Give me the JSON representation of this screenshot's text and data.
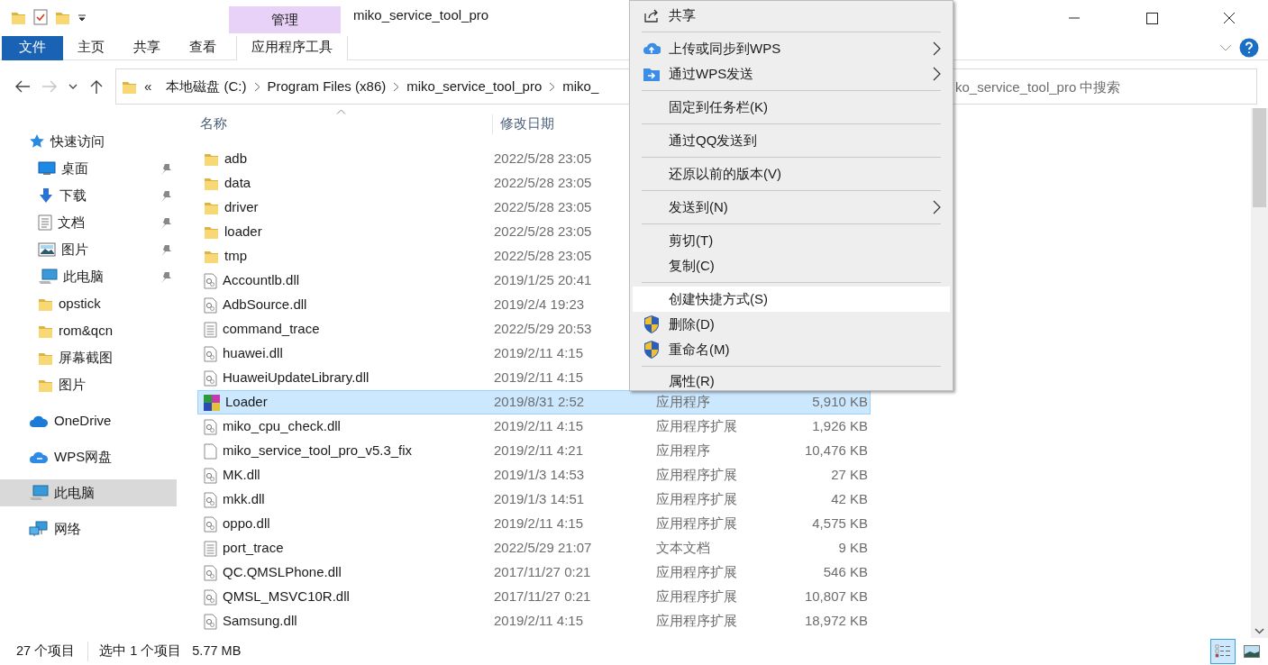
{
  "window": {
    "title": "miko_service_tool_pro",
    "context_group": "管理"
  },
  "ribbon": {
    "tabs": [
      {
        "label": "文件",
        "kind": "file"
      },
      {
        "label": "主页",
        "kind": "tab"
      },
      {
        "label": "共享",
        "kind": "tab"
      },
      {
        "label": "查看",
        "kind": "tab"
      },
      {
        "label": "应用程序工具",
        "kind": "context"
      }
    ]
  },
  "navigation": {
    "back": {
      "disabled": false
    },
    "forward": {
      "disabled": true
    }
  },
  "address_bar": {
    "overflow": "«",
    "path": [
      "本地磁盘 (C:)",
      "Program Files (x86)",
      "miko_service_tool_pro",
      "miko_"
    ]
  },
  "search": {
    "placeholder": "ko_service_tool_pro 中搜索"
  },
  "sidebar": {
    "items": [
      {
        "label": "快速访问",
        "kind": "star",
        "selected": false,
        "children": [
          {
            "label": "桌面",
            "kind": "desktop",
            "pinned": true,
            "selected": false
          },
          {
            "label": "下载",
            "kind": "download",
            "pinned": true,
            "selected": false
          },
          {
            "label": "文档",
            "kind": "document",
            "pinned": true,
            "selected": false
          },
          {
            "label": "图片",
            "kind": "pictures",
            "pinned": true,
            "selected": false
          },
          {
            "label": "此电脑",
            "kind": "pc",
            "pinned": true,
            "selected": false
          },
          {
            "label": "opstick",
            "kind": "folder",
            "pinned": false,
            "selected": false
          },
          {
            "label": "rom&qcn",
            "kind": "folder",
            "pinned": false,
            "selected": false
          },
          {
            "label": "屏幕截图",
            "kind": "folder",
            "pinned": false,
            "selected": false
          },
          {
            "label": "图片",
            "kind": "folder",
            "pinned": false,
            "selected": false
          }
        ]
      },
      {
        "label": "OneDrive",
        "kind": "cloud",
        "selected": false
      },
      {
        "label": "WPS网盘",
        "kind": "wpscloud",
        "selected": false
      },
      {
        "label": "此电脑",
        "kind": "pc",
        "selected": true
      },
      {
        "label": "网络",
        "kind": "network",
        "selected": false
      }
    ]
  },
  "file_list": {
    "columns": [
      "名称",
      "修改日期"
    ],
    "rows": [
      {
        "name": "adb",
        "date": "2022/5/28 23:05",
        "kind": "folder",
        "selected": false
      },
      {
        "name": "data",
        "date": "2022/5/28 23:05",
        "kind": "folder",
        "selected": false
      },
      {
        "name": "driver",
        "date": "2022/5/28 23:05",
        "kind": "folder",
        "selected": false
      },
      {
        "name": "loader",
        "date": "2022/5/28 23:05",
        "kind": "folder",
        "selected": false
      },
      {
        "name": "tmp",
        "date": "2022/5/28 23:05",
        "kind": "folder",
        "selected": false
      },
      {
        "name": "Accountlb.dll",
        "date": "2019/1/25 20:41",
        "kind": "dll",
        "selected": false
      },
      {
        "name": "AdbSource.dll",
        "date": "2019/2/4 19:23",
        "kind": "dll",
        "selected": false
      },
      {
        "name": "command_trace",
        "date": "2022/5/29 20:53",
        "kind": "text",
        "selected": false
      },
      {
        "name": "huawei.dll",
        "date": "2019/2/11 4:15",
        "kind": "dll",
        "selected": false
      },
      {
        "name": "HuaweiUpdateLibrary.dll",
        "date": "2019/2/11 4:15",
        "kind": "dll",
        "selected": false
      },
      {
        "name": "Loader",
        "date": "2019/8/31 2:52",
        "type": "应用程序",
        "size": "5,910 KB",
        "kind": "app",
        "selected": true
      },
      {
        "name": "miko_cpu_check.dll",
        "date": "2019/2/11 4:15",
        "type": "应用程序扩展",
        "size": "1,926 KB",
        "kind": "dll",
        "selected": false
      },
      {
        "name": "miko_service_tool_pro_v5.3_fix",
        "date": "2019/2/11 4:21",
        "type": "应用程序",
        "size": "10,476 KB",
        "kind": "blank",
        "selected": false
      },
      {
        "name": "MK.dll",
        "date": "2019/1/3 14:53",
        "type": "应用程序扩展",
        "size": "27 KB",
        "kind": "dll",
        "selected": false
      },
      {
        "name": "mkk.dll",
        "date": "2019/1/3 14:51",
        "type": "应用程序扩展",
        "size": "42 KB",
        "kind": "dll",
        "selected": false
      },
      {
        "name": "oppo.dll",
        "date": "2019/2/11 4:15",
        "type": "应用程序扩展",
        "size": "4,575 KB",
        "kind": "dll",
        "selected": false
      },
      {
        "name": "port_trace",
        "date": "2022/5/29 21:07",
        "type": "文本文档",
        "size": "9 KB",
        "kind": "text",
        "selected": false
      },
      {
        "name": "QC.QMSLPhone.dll",
        "date": "2017/11/27 0:21",
        "type": "应用程序扩展",
        "size": "546 KB",
        "kind": "dll",
        "selected": false
      },
      {
        "name": "QMSL_MSVC10R.dll",
        "date": "2017/11/27 0:21",
        "type": "应用程序扩展",
        "size": "10,807 KB",
        "kind": "dll",
        "selected": false
      },
      {
        "name": "Samsung.dll",
        "date": "2019/2/11 4:15",
        "type": "应用程序扩展",
        "size": "18,972 KB",
        "kind": "dll",
        "selected": false
      }
    ]
  },
  "context_menu": {
    "items": [
      {
        "kind": "share",
        "label": "共享",
        "submenu": false,
        "selected": false
      },
      {
        "kind": "separator"
      },
      {
        "kind": "upload",
        "label": "上传或同步到WPS",
        "submenu": true,
        "selected": false
      },
      {
        "kind": "send",
        "label": "通过WPS发送",
        "submenu": true,
        "selected": false
      },
      {
        "kind": "separator"
      },
      {
        "kind": "item",
        "label": "固定到任务栏(K)",
        "submenu": false,
        "selected": false
      },
      {
        "kind": "separator"
      },
      {
        "kind": "item",
        "label": "通过QQ发送到",
        "submenu": false,
        "selected": false
      },
      {
        "kind": "separator"
      },
      {
        "kind": "item",
        "label": "还原以前的版本(V)",
        "submenu": false,
        "selected": false
      },
      {
        "kind": "separator"
      },
      {
        "kind": "item",
        "label": "发送到(N)",
        "submenu": true,
        "selected": false
      },
      {
        "kind": "separator"
      },
      {
        "kind": "item",
        "label": "剪切(T)",
        "submenu": false,
        "selected": false
      },
      {
        "kind": "item",
        "label": "复制(C)",
        "submenu": false,
        "selected": false
      },
      {
        "kind": "separator"
      },
      {
        "kind": "item",
        "label": "创建快捷方式(S)",
        "submenu": false,
        "selected": true
      },
      {
        "kind": "shield",
        "label": "删除(D)",
        "submenu": false,
        "selected": false
      },
      {
        "kind": "shield",
        "label": "重命名(M)",
        "submenu": false,
        "selected": false
      },
      {
        "kind": "separator"
      },
      {
        "kind": "item",
        "label": "属性(R)",
        "submenu": false,
        "selected": false
      }
    ]
  },
  "status_bar": {
    "count": "27 个项目",
    "selection": "选中 1 个项目",
    "size": "5.77 MB"
  },
  "view_buttons": [
    {
      "kind": "details",
      "selected": true
    },
    {
      "kind": "large_icons",
      "selected": false
    }
  ]
}
